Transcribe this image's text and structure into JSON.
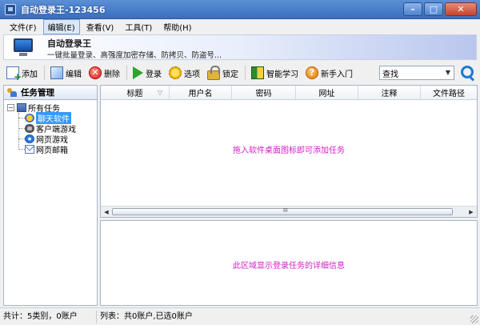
{
  "window": {
    "title": "自动登录王-123456",
    "minimize": "–",
    "maximize": "□",
    "close": "✕"
  },
  "menu": [
    {
      "label": "文件(F)",
      "active": false
    },
    {
      "label": "编辑(E)",
      "active": true
    },
    {
      "label": "查看(V)",
      "active": false
    },
    {
      "label": "工具(T)",
      "active": false
    },
    {
      "label": "帮助(H)",
      "active": false
    }
  ],
  "banner": {
    "title": "自动登录王",
    "subtitle": "一键批量登录、高强度加密存储、防拷贝、防盗号..."
  },
  "toolbar": {
    "add": "添加",
    "edit": "编辑",
    "delete": "删除",
    "login": "登录",
    "options": "选项",
    "lock": "锁定",
    "learn": "智能学习",
    "guide": "新手入门",
    "delete_glyph": "✕",
    "help_glyph": "?"
  },
  "search": {
    "value": "查找",
    "dropdown": "▼"
  },
  "left_panel": {
    "title": "任务管理",
    "tree": {
      "root": {
        "label": "所有任务",
        "toggle": "−"
      },
      "children": [
        {
          "label": "聊天软件",
          "selected": true,
          "icon": "chat-icon"
        },
        {
          "label": "客户端游戏",
          "selected": false,
          "icon": "gamepad-icon"
        },
        {
          "label": "网页游戏",
          "selected": false,
          "icon": "browser-icon"
        },
        {
          "label": "网页邮箱",
          "selected": false,
          "icon": "mail-icon"
        }
      ]
    }
  },
  "table": {
    "columns": [
      "标题",
      "用户名",
      "密码",
      "网址",
      "注释",
      "文件路径"
    ],
    "sort_glyph": "▽",
    "empty_message": "拖入软件桌面图标即可添加任务"
  },
  "scrollbar": {
    "left": "◀",
    "right": "▶"
  },
  "detail": {
    "message": "此区域显示登录任务的详细信息"
  },
  "status": {
    "left": "共计：5类别，0账户",
    "right": "列表：共0账户,已选0账户"
  },
  "colors": {
    "titlebar": "#3a6fbf",
    "highlight_text": "#d21ec8",
    "selection": "#3399ff"
  }
}
